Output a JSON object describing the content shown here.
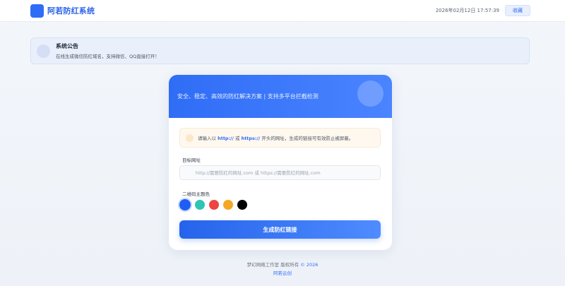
{
  "header": {
    "brand_name": "阿若防红系统",
    "datetime": "2026年02月12日 17:57:39",
    "favorite_label": "收藏"
  },
  "notice": {
    "title": "系统公告",
    "text": "在线生成微信防红域名，支持微信、QQ直接打开！"
  },
  "card": {
    "hero_text": "安全、稳定、高效的防红解决方案 | 支持多平台拦截检测",
    "tip": {
      "prefix": "请输入以 ",
      "http": "http://",
      "middle": " 或 ",
      "https": "https://",
      "suffix": " 开头的网址，生成的链接可有效防止被屏蔽。"
    },
    "url_label": "目标网址",
    "url_value": "",
    "url_placeholder": "http://需要防红的网址.com 或 https://需要防红的网址.com",
    "color_label": "二维码主题色",
    "colors": [
      "#1f5ef5",
      "#2ec4b6",
      "#ef4444",
      "#f5a623",
      "#000000"
    ],
    "selected_color": "#1f5ef5",
    "generate_label": "生成防红链接"
  },
  "footer": {
    "copyright": "梦幻网络工作室 版权所有 ",
    "year": "© 2026",
    "link": "阿若云创"
  },
  "theme": {
    "accent": "#2f6df6"
  }
}
